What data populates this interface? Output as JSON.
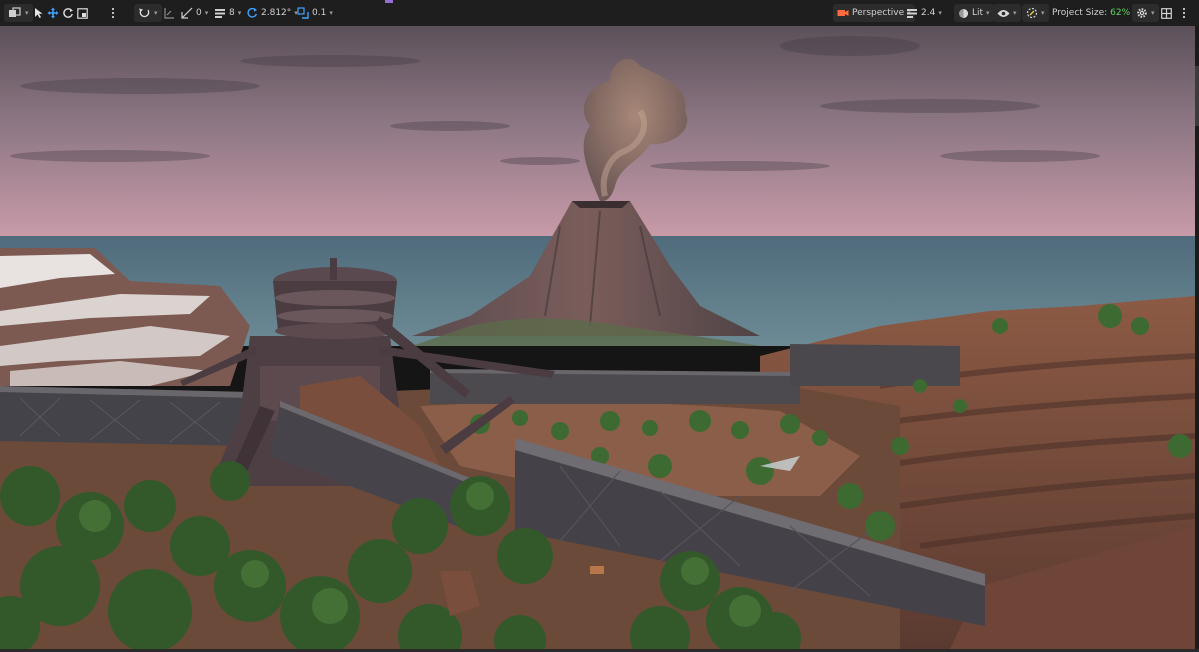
{
  "toolbar": {
    "left": {
      "snap_angle_value": "0",
      "grid_value": "8",
      "rotation_snap_value": "2.812°",
      "scale_snap_value": "0.1"
    },
    "right": {
      "view_mode_label": "Perspective",
      "camera_speed_value": "2.4",
      "lighting_mode_label": "Lit",
      "project_size_label": "Project Size:",
      "project_size_value": "62%"
    },
    "icons": [
      "mode-select-icon",
      "select-arrow-icon",
      "move-icon",
      "rotate-icon",
      "scale-icon",
      "more-icon",
      "transform-space-icon",
      "surface-snap-icon",
      "grid-snap-icon",
      "grid-icon",
      "rotation-snap-icon",
      "scale-snap-icon",
      "camera-icon",
      "viewport-size-icon",
      "lit-sphere-icon",
      "visibility-eye-icon",
      "camera-effects-icon",
      "settings-gear-icon",
      "layout-grid-icon"
    ],
    "colors": {
      "bar_bg": "#1e1e1e",
      "accent_green": "#5fd35f",
      "accent_purple": "#9a6fd4"
    }
  },
  "viewport": {
    "scene": "level editor perspective view: volcano with smoke plume, ocean horizon, snowy cliffs, round tower structure, long wall segments, forested valley, terraced red-earth hills",
    "colors": {
      "sky_top": "#6d5f68",
      "sky_horizon": "#c59aa8",
      "ocean": "#5b7785",
      "terrain": "#8a5a47",
      "foliage": "#3e6a30"
    }
  }
}
